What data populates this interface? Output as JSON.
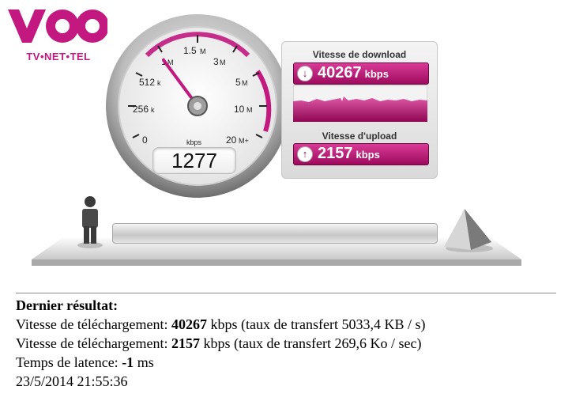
{
  "brand": {
    "tagline": "TV•NET•TEL",
    "color": "#c2187f"
  },
  "gauge": {
    "scale_labels": [
      "0",
      "256",
      "k",
      "512",
      "k",
      "1",
      "M",
      "1.5",
      "M",
      "3",
      "M",
      "5",
      "M",
      "10",
      "M",
      "20",
      "M+"
    ],
    "unit": "kbps",
    "current_value": "1277",
    "accent_color": "#c2187f"
  },
  "download": {
    "title": "Vitesse de download",
    "value": "40267",
    "unit": "kbps",
    "icon": "arrow-down-icon"
  },
  "upload": {
    "title": "Vitesse d'upload",
    "value": "2157",
    "unit": "kbps",
    "icon": "arrow-up-icon"
  },
  "results": {
    "heading": "Dernier résultat:",
    "line1_prefix": "Vitesse de téléchargement: ",
    "line1_value": "40267",
    "line1_suffix": " kbps (taux de transfert 5033,4 KB / s)",
    "line2_prefix": "Vitesse de téléchargement: ",
    "line2_value": "2157",
    "line2_suffix": " kbps (taux de transfert 269,6 Ko / sec)",
    "line3_prefix": "Temps de latence: ",
    "line3_value": "-1",
    "line3_suffix": " ms",
    "timestamp": "23/5/2014 21:55:36"
  }
}
